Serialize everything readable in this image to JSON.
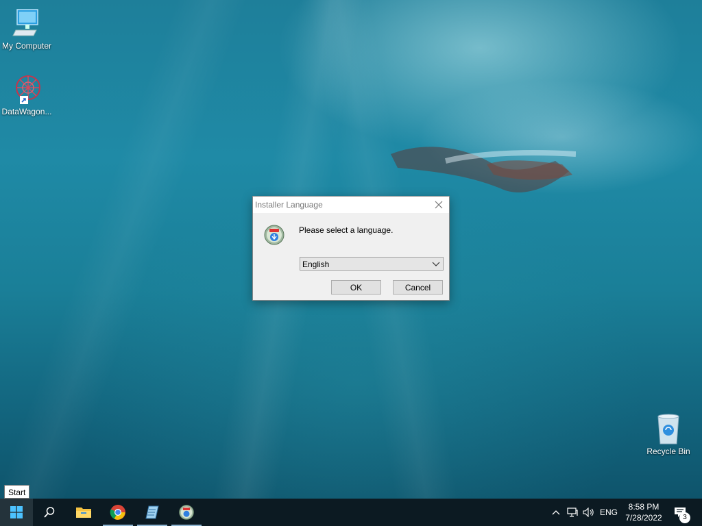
{
  "desktop": {
    "icons": [
      {
        "label": "My Computer",
        "icon": "computer-icon"
      },
      {
        "label": "DataWagon...",
        "icon": "datawagon-icon"
      },
      {
        "label": "Recycle Bin",
        "icon": "recycle-bin-icon"
      }
    ]
  },
  "dialog": {
    "title": "Installer Language",
    "prompt": "Please select a language.",
    "language_select": {
      "selected": "English"
    },
    "ok_label": "OK",
    "cancel_label": "Cancel"
  },
  "tooltip": {
    "text": "Start"
  },
  "taskbar": {
    "apps": [
      {
        "name": "start",
        "icon": "windows-icon"
      },
      {
        "name": "search",
        "icon": "search-icon"
      },
      {
        "name": "file-explorer",
        "icon": "folder-icon"
      },
      {
        "name": "chrome",
        "icon": "chrome-icon"
      },
      {
        "name": "notepad",
        "icon": "notepad-icon"
      },
      {
        "name": "installer",
        "icon": "installer-icon"
      }
    ],
    "tray": {
      "language": "ENG",
      "time": "8:58 PM",
      "date": "7/28/2022",
      "notification_count": "3"
    }
  },
  "colors": {
    "taskbar": "#0c1a22",
    "dialog_bg": "#f0f0f0",
    "button_bg": "#e1e1e1",
    "active_indicator": "#8fb6d2"
  }
}
